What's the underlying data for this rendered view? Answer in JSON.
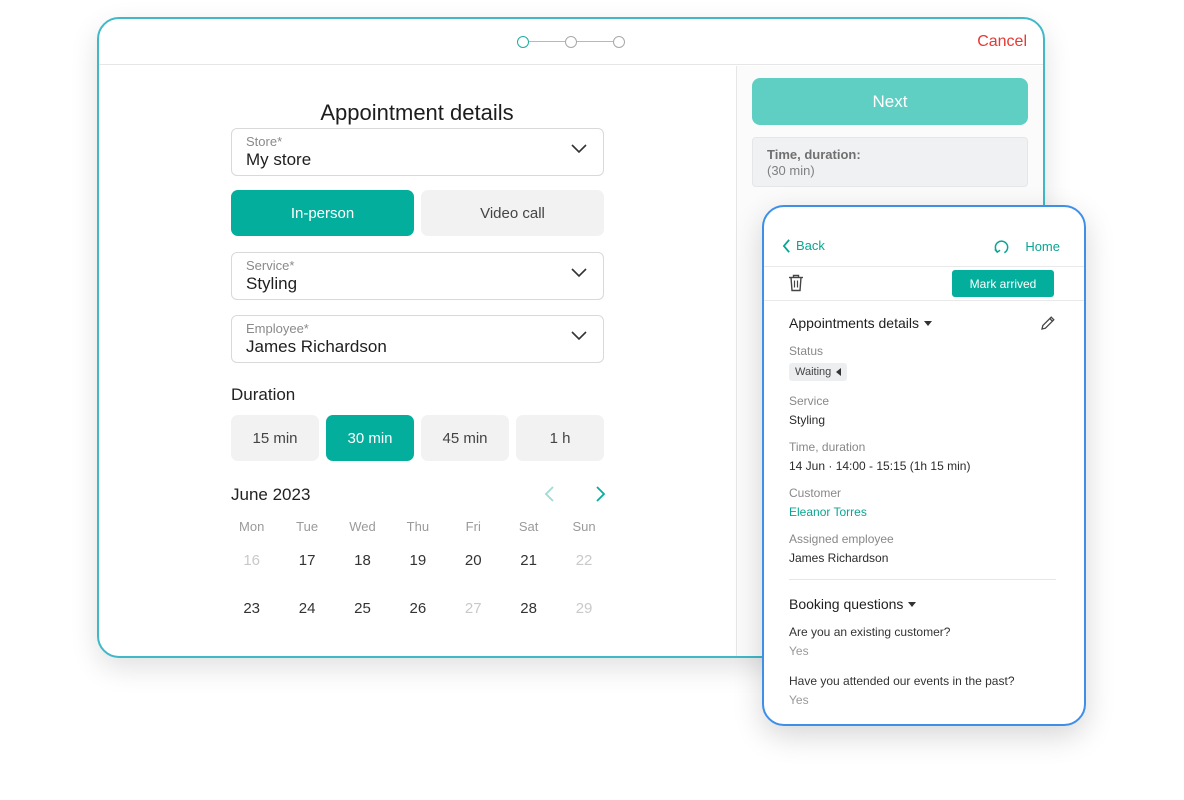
{
  "tablet": {
    "cancel_label": "Cancel",
    "title": "Appointment details",
    "store": {
      "label": "Store*",
      "value": "My store"
    },
    "mode": {
      "in_person": "In-person",
      "video_call": "Video call",
      "selected": "In-person"
    },
    "service": {
      "label": "Service*",
      "value": "Styling"
    },
    "employee": {
      "label": "Employee*",
      "value": "James Richardson"
    },
    "duration": {
      "label": "Duration",
      "options": [
        "15 min",
        "30 min",
        "45 min",
        "1 h"
      ],
      "selected": "30 min"
    },
    "calendar": {
      "month": "June 2023",
      "weekdays": [
        "Mon",
        "Tue",
        "Wed",
        "Thu",
        "Fri",
        "Sat",
        "Sun"
      ],
      "weeks": [
        [
          "16",
          "17",
          "18",
          "19",
          "20",
          "21",
          "22"
        ],
        [
          "23",
          "24",
          "25",
          "26",
          "27",
          "28",
          "29"
        ]
      ],
      "muted_days": [
        "16",
        "22",
        "27",
        "29"
      ]
    },
    "next_label": "Next",
    "summary": {
      "title": "Time, duration:",
      "value": "(30 min)"
    }
  },
  "phone": {
    "back_label": "Back",
    "home_label": "Home",
    "mark_arrived_label": "Mark arrived",
    "details_title": "Appointments details",
    "status": {
      "label": "Status",
      "value": "Waiting"
    },
    "service": {
      "label": "Service",
      "value": "Styling"
    },
    "time": {
      "label": "Time, duration",
      "value": "14 Jun · 14:00 - 15:15 (1h 15 min)"
    },
    "customer": {
      "label": "Customer",
      "value": "Eleanor Torres"
    },
    "employee": {
      "label": "Assigned employee",
      "value": "James Richardson"
    },
    "booking_title": "Booking questions",
    "questions": [
      {
        "q": "Are you an existing customer?",
        "a": "Yes"
      },
      {
        "q": "Have you attended our events in the past?",
        "a": "Yes"
      }
    ]
  },
  "colors": {
    "accent": "#03ae9c",
    "accent_light": "#5fcfc4",
    "cancel": "#e53935",
    "tablet_border": "#3fb8c8",
    "phone_border": "#3d8fe8"
  }
}
